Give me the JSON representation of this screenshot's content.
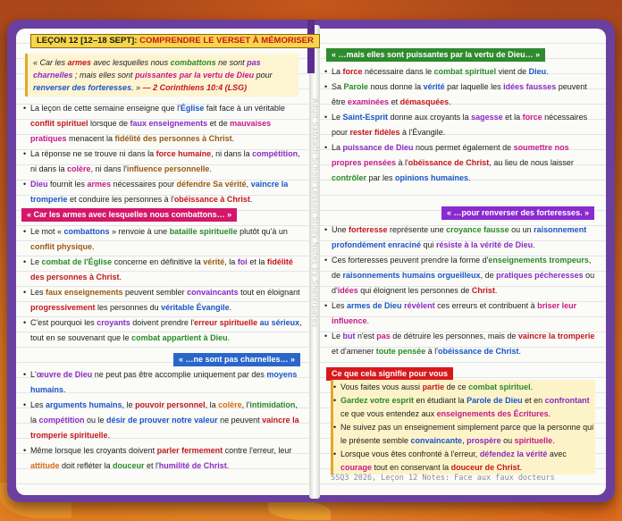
{
  "header": {
    "lesson": "LEÇON 12 [12–18 SEPT]:",
    "topic": "COMPRENDRE LE VERSET À MÉMORISER"
  },
  "verse": {
    "t1": "« Car les ",
    "armes": "armes",
    "t2": " avec lesquelles nous ",
    "combattons": "combattons",
    "t3": " ne sont ",
    "pas": "pas",
    "charnelles": "charnelles",
    "t4": " ; mais elles sont ",
    "puissantes": "puissantes par la vertu de Dieu",
    "t5": " pour ",
    "renverser": "renverser des forteresses",
    "t6": ". » ",
    "ref": "— 2 Corinthiens 10:4 (LSG)"
  },
  "watermark": "Adult Sabbath School Lesson Study Notes by Shelerpates",
  "left_intro": [
    [
      "La leçon de cette semaine enseigne que l'",
      "Église",
      " fait face à un véritable ",
      "conflit spirituel",
      " lorsque de ",
      "faux enseignements",
      " et de ",
      "mauvaises pratiques",
      " menacent la ",
      "fidélité des personnes à Christ",
      "."
    ],
    [
      "La réponse ne se trouve ni dans la ",
      "force humaine",
      ", ni dans la ",
      "compétition",
      ", ni dans la ",
      "colère",
      ", ni dans l'",
      "influence personnelle",
      "."
    ],
    [
      "",
      "Dieu",
      " fournit les ",
      "armes",
      " nécessaires pour ",
      "défendre Sa vérité",
      ", ",
      "vaincre la tromperie",
      " et conduire les personnes à l'",
      "obéissance à Christ",
      "."
    ]
  ],
  "banners": {
    "arms": "« Car les armes avec lesquelles nous combattons… »",
    "carnal": "« …ne sont pas charnelles… »",
    "mighty": "« …mais elles sont puissantes par la vertu de Dieu… »",
    "strongholds": "« …pour renverser des forteresses. »",
    "meaning": "Ce que cela signifie pour vous"
  },
  "left_arms": [
    [
      "Le mot « ",
      "combattons",
      " » renvoie à une ",
      "bataille spirituelle",
      " plutôt qu'à un ",
      "conflit physique",
      "."
    ],
    [
      "Le ",
      "combat de l'Église",
      " concerne en définitive la ",
      "vérité",
      ", la ",
      "foi",
      " et la ",
      "fidélité des personnes à Christ",
      "."
    ],
    [
      "Les ",
      "faux enseignements",
      " peuvent sembler ",
      "convaincants",
      " tout en éloignant ",
      "progressivement",
      " les personnes du ",
      "véritable Évangile",
      "."
    ],
    [
      "C'est pourquoi les ",
      "croyants",
      " doivent prendre l'",
      "erreur spirituelle",
      " ",
      "au sérieux",
      ", tout en se souvenant que le ",
      "combat appartient à Dieu",
      "."
    ]
  ],
  "left_carnal": [
    [
      "L'",
      "œuvre de Dieu",
      " ne peut pas être accomplie uniquement par des ",
      "moyens humains",
      "."
    ],
    [
      "Les ",
      "arguments humains",
      ", le ",
      "pouvoir personnel",
      ", la ",
      "colère",
      ", l'",
      "intimidation",
      ", la ",
      "compétition",
      " ou le ",
      "désir de prouver notre valeur",
      " ne peuvent ",
      "vaincre la tromperie spirituelle",
      "."
    ],
    [
      "Même lorsque les croyants doivent ",
      "parler fermement",
      " contre l'erreur, leur ",
      "attitude",
      " doit refléter la ",
      "douceur",
      " et l'",
      "humilité de Christ",
      "."
    ]
  ],
  "right_mighty": [
    [
      "La ",
      "force",
      " nécessaire dans le ",
      "combat spirituel",
      " vient de ",
      "Dieu",
      "."
    ],
    [
      "Sa ",
      "Parole",
      " nous donne la ",
      "vérité",
      " par laquelle les ",
      "idées fausses",
      " peuvent être ",
      "examinées",
      " et ",
      "démasquées",
      "."
    ],
    [
      "Le ",
      "Saint-Esprit",
      " donne aux croyants la ",
      "sagesse",
      " et la ",
      "force",
      " nécessaires pour ",
      "rester fidèles",
      " à l'Évangile."
    ],
    [
      "La ",
      "puissance de Dieu",
      " nous permet également de ",
      "soumettre nos propres pensées",
      " à l'",
      "obéissance de Christ",
      ", au lieu de nous laisser ",
      "contrôler",
      " par les ",
      "opinions humaines",
      "."
    ]
  ],
  "right_strong": [
    [
      "Une ",
      "forteresse",
      " représente une ",
      "croyance fausse",
      " ou un ",
      "raisonnement profondément enraciné",
      " qui ",
      "résiste à la vérité de Dieu",
      "."
    ],
    [
      "Ces forteresses peuvent prendre la forme d'",
      "enseignements trompeurs",
      ", de ",
      "raisonnements humains orgueilleux",
      ", de ",
      "pratiques pécheresses",
      " ou d'",
      "idées",
      " qui éloignent les personnes de ",
      "Christ",
      "."
    ],
    [
      "Les ",
      "armes de Dieu",
      " ",
      "révèlent",
      " ces erreurs et contribuent à ",
      "briser leur influence",
      "."
    ],
    [
      "Le ",
      "but",
      " n'est ",
      "pas",
      " de détruire les personnes, mais de ",
      "vaincre la tromperie",
      " et d'amener ",
      "toute pensée",
      " à l'",
      "obéissance de Christ",
      "."
    ]
  ],
  "right_meaning": [
    [
      "Vous faites vous aussi ",
      "partie",
      " de ce ",
      "combat spirituel",
      "."
    ],
    [
      "",
      "Gardez votre esprit",
      " en étudiant la ",
      "Parole de Dieu",
      " et en ",
      "confrontant",
      " ce que vous entendez aux ",
      "enseignements des Écritures",
      "."
    ],
    [
      "Ne suivez pas un enseignement simplement parce que la personne qui le présente semble ",
      "convaincante",
      ", ",
      "prospère",
      " ou ",
      "spirituelle",
      "."
    ],
    [
      "Lorsque vous êtes confronté à l'erreur, ",
      "défendez la vérité",
      " avec ",
      "courage",
      " tout en conservant la ",
      "douceur de Christ",
      "."
    ]
  ],
  "footer": "SSQ3 2026, Leçon 12 Notes: Face aux faux docteurs",
  "colors": {
    "cover": "#6b3fa0",
    "banner_green": "#2e8b2e",
    "banner_pink": "#d3176a",
    "banner_blue": "#2a66c9",
    "banner_purple": "#8a2ad0",
    "banner_red": "#d8191c",
    "title_yellow": "#f6d54a"
  }
}
